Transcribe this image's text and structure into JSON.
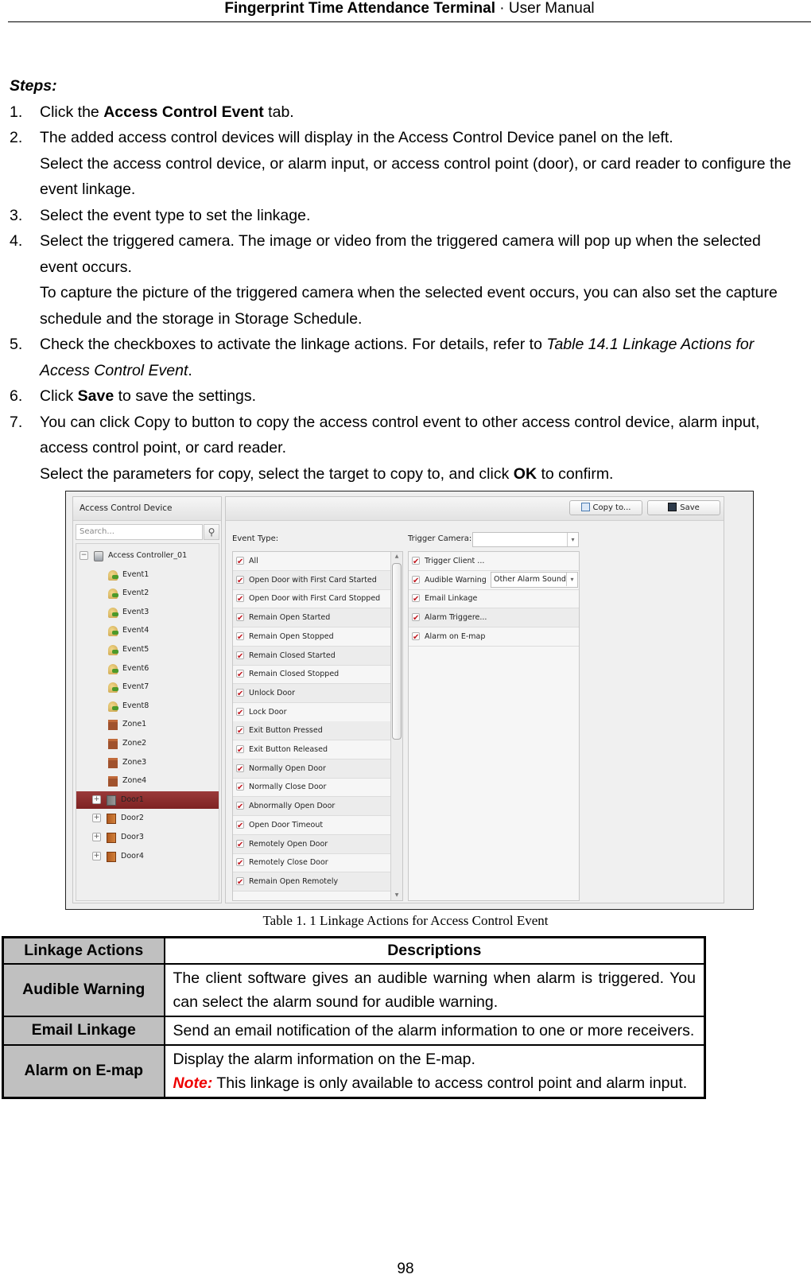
{
  "header": {
    "title_bold": "Fingerprint Time Attendance Terminal",
    "separator": "·",
    "title_regular": "User Manual"
  },
  "steps_title": "Steps:",
  "steps": [
    {
      "num": "1.",
      "pre": "Click the ",
      "bold": "Access Control Event",
      "post": " tab."
    },
    {
      "num": "2.",
      "text": "The added access control devices will display in the Access Control Device panel on the left.",
      "sub": "Select the access control device, or alarm input, or access control point (door), or card reader to configure the event linkage."
    },
    {
      "num": "3.",
      "text": "Select the event type to set the linkage."
    },
    {
      "num": "4.",
      "text": "Select the triggered camera. The image or video from the triggered camera will pop up when the selected event occurs.",
      "sub": "To capture the picture of the triggered camera when the selected event occurs, you can also set the capture schedule and the storage in Storage Schedule."
    },
    {
      "num": "5.",
      "pre": "Check the checkboxes to activate the linkage actions. For details, refer to ",
      "italic": "Table 14.1 Linkage Actions for Access Control Event",
      "post": "."
    },
    {
      "num": "6.",
      "pre": "Click ",
      "bold": "Save",
      "post": " to save the settings."
    },
    {
      "num": "7.",
      "text": "You can click Copy to button to copy the access control event to other access control device, alarm input, access control point, or card reader.",
      "sub_pre": "Select the parameters for copy, select the target to copy to, and click ",
      "sub_bold": "OK",
      "sub_post": " to confirm."
    }
  ],
  "screenshot": {
    "left_panel": {
      "title": "Access Control Device",
      "search_placeholder": "Search...",
      "tree": [
        {
          "label": "Access Controller_01",
          "type": "controller",
          "expander": "−"
        },
        {
          "label": "Event1",
          "type": "event"
        },
        {
          "label": "Event2",
          "type": "event"
        },
        {
          "label": "Event3",
          "type": "event"
        },
        {
          "label": "Event4",
          "type": "event"
        },
        {
          "label": "Event5",
          "type": "event"
        },
        {
          "label": "Event6",
          "type": "event"
        },
        {
          "label": "Event7",
          "type": "event"
        },
        {
          "label": "Event8",
          "type": "event"
        },
        {
          "label": "Zone1",
          "type": "zone"
        },
        {
          "label": "Zone2",
          "type": "zone"
        },
        {
          "label": "Zone3",
          "type": "zone"
        },
        {
          "label": "Zone4",
          "type": "zone"
        },
        {
          "label": "Door1",
          "type": "door",
          "expander": "+",
          "selected": true
        },
        {
          "label": "Door2",
          "type": "door",
          "expander": "+"
        },
        {
          "label": "Door3",
          "type": "door",
          "expander": "+"
        },
        {
          "label": "Door4",
          "type": "door",
          "expander": "+"
        }
      ]
    },
    "toolbar": {
      "copy_label": "Copy to...",
      "save_label": "Save"
    },
    "event_type_label": "Event Type:",
    "trigger_camera_label": "Trigger Camera:",
    "trigger_camera_value": "",
    "event_types": [
      {
        "label": "All",
        "checked": true
      },
      {
        "label": "Open Door with First Card Started",
        "checked": true
      },
      {
        "label": "Open Door with First Card Stopped",
        "checked": true
      },
      {
        "label": "Remain Open Started",
        "checked": true
      },
      {
        "label": "Remain Open Stopped",
        "checked": true
      },
      {
        "label": "Remain Closed Started",
        "checked": true
      },
      {
        "label": "Remain Closed Stopped",
        "checked": true
      },
      {
        "label": "Unlock Door",
        "checked": true
      },
      {
        "label": "Lock Door",
        "checked": true
      },
      {
        "label": "Exit Button Pressed",
        "checked": true
      },
      {
        "label": "Exit Button Released",
        "checked": true
      },
      {
        "label": "Normally Open Door",
        "checked": true
      },
      {
        "label": "Normally Close Door",
        "checked": true
      },
      {
        "label": "Abnormally Open Door",
        "checked": true
      },
      {
        "label": "Open Door Timeout",
        "checked": true
      },
      {
        "label": "Remotely Open Door",
        "checked": true
      },
      {
        "label": "Remotely Close Door",
        "checked": true
      },
      {
        "label": "Remain Open Remotely",
        "checked": true
      }
    ],
    "linkage_actions": [
      {
        "label": "Trigger Client ...",
        "checked": true
      },
      {
        "label": "Audible Warning",
        "checked": true,
        "select_value": "Other Alarm Sound"
      },
      {
        "label": "Email Linkage",
        "checked": true
      },
      {
        "label": "Alarm Triggere...",
        "checked": true
      },
      {
        "label": "Alarm on E-map",
        "checked": true
      }
    ]
  },
  "table": {
    "caption": "Table 1. 1 Linkage Actions for Access Control Event",
    "headers": [
      "Linkage Actions",
      "Descriptions"
    ],
    "rows": [
      {
        "action": "Audible Warning",
        "desc": "The client software gives an audible warning when alarm is triggered. You can select the alarm sound for audible warning."
      },
      {
        "action": "Email Linkage",
        "desc": "Send an email notification of the alarm information to one or more receivers."
      },
      {
        "action": "Alarm on E-map",
        "desc": "Display the alarm information on the E-map.",
        "note_label": "Note:",
        "note_text": " This linkage is only available to access control point and alarm input."
      }
    ]
  },
  "page_number": "98",
  "colors": {
    "selected_row": "#8b2a2a",
    "checkmark": "#c0171f",
    "note": "#e00000",
    "table_header": "#c0c0c0"
  }
}
